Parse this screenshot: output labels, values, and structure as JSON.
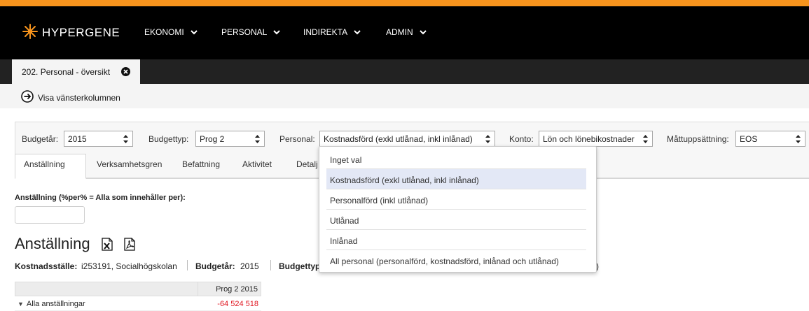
{
  "colors": {
    "accent": "#f7941d",
    "navbar": "#000000",
    "negative": "#e0141e",
    "selected_option_bg": "#e3e8f6"
  },
  "brand": {
    "name": "HYPERGENE",
    "icon": "hypergene-logo-icon"
  },
  "nav": [
    {
      "label": "EKONOMI",
      "icon": "chevron-down-icon"
    },
    {
      "label": "PERSONAL",
      "icon": "chevron-down-icon"
    },
    {
      "label": "INDIREKTA",
      "icon": "chevron-down-icon"
    },
    {
      "label": "ADMIN",
      "icon": "chevron-down-icon"
    }
  ],
  "doc_tab": {
    "label": "202. Personal - översikt",
    "close_icon": "close-circle-icon"
  },
  "show_left": {
    "label": "Visa vänsterkolumnen",
    "icon": "arrow-right-circle-icon"
  },
  "filters": {
    "budgetar": {
      "label": "Budgetår:",
      "value": "2015"
    },
    "budgettyp": {
      "label": "Budgettyp:",
      "value": "Prog 2"
    },
    "personal": {
      "label": "Personal:",
      "value": "Kostnadsförd (exkl utlånad, inkl inlånad)"
    },
    "konto": {
      "label": "Konto:",
      "value": "Lön och lönebikostnader"
    },
    "mattuppsattning": {
      "label": "Måttuppsättning:",
      "value": "EOS"
    }
  },
  "subtabs": [
    "Anställning",
    "Verksamhetsgren",
    "Befattning",
    "Aktivitet",
    "Detalj"
  ],
  "active_subtab": "Anställning",
  "filter_field": {
    "label": "Anställning (%per% = Alla som innehåller per):",
    "value": ""
  },
  "section": {
    "title": "Anställning",
    "excel_icon": "excel-export-icon",
    "pdf_icon": "pdf-export-icon"
  },
  "meta": {
    "kostnadsstalle_label": "Kostnadsställe:",
    "kostnadsstalle_value": "i253191, Socialhögskolan",
    "budgetar_label": "Budgetår:",
    "budgetar_value": "2015",
    "budgettyp_label": "Budgettyp",
    "trailing": ")"
  },
  "table": {
    "column": "Prog 2 2015",
    "rows": [
      {
        "name": "Alla anställningar",
        "value": "-64 524 518"
      }
    ]
  },
  "personal_dropdown": {
    "options": [
      "Inget val",
      "Kostnadsförd (exkl utlånad, inkl inlånad)",
      "Personalförd (inkl utlånad)",
      "Utlånad",
      "Inlånad",
      "All personal (personalförd, kostnadsförd, inlånad och utlånad)"
    ],
    "selected": "Kostnadsförd (exkl utlånad, inkl inlånad)"
  }
}
